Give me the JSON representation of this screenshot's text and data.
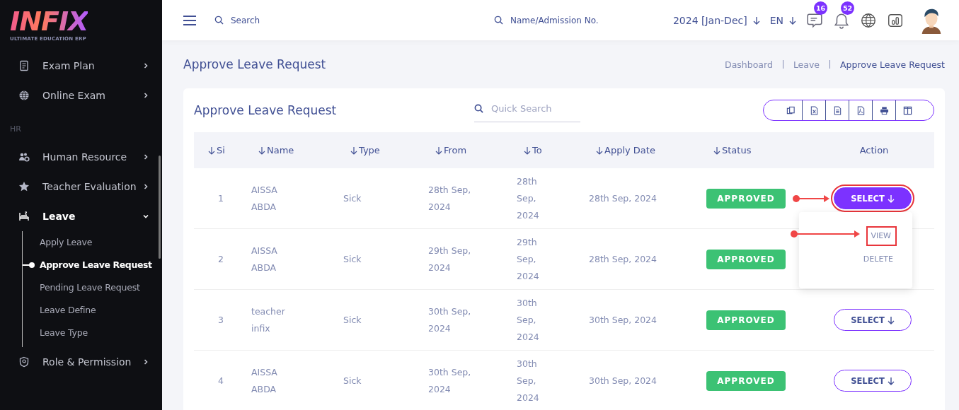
{
  "brand": {
    "name": "INFIX",
    "tagline": "ULTIMATE EDUCATION ERP"
  },
  "sidebar": {
    "items": [
      {
        "label": "Exam Plan",
        "expanded": false
      },
      {
        "label": "Online Exam",
        "expanded": false
      }
    ],
    "section": "HR",
    "section_items": [
      {
        "label": "Human Resource",
        "expanded": false
      },
      {
        "label": "Teacher Evaluation",
        "expanded": false
      },
      {
        "label": "Leave",
        "expanded": true,
        "children": [
          {
            "label": "Apply Leave",
            "selected": false
          },
          {
            "label": "Approve Leave Request",
            "selected": true
          },
          {
            "label": "Pending Leave Request",
            "selected": false
          },
          {
            "label": "Leave Define",
            "selected": false
          },
          {
            "label": "Leave Type",
            "selected": false
          }
        ]
      },
      {
        "label": "Role & Permission",
        "expanded": false
      }
    ]
  },
  "topbar": {
    "search": {
      "placeholder": "Search"
    },
    "student_search": {
      "placeholder": "Name/Admission No."
    },
    "session": "2024 [Jan-Dec]",
    "language": "EN",
    "messages_badge": "16",
    "notifications_badge": "52"
  },
  "page": {
    "title": "Approve Leave Request",
    "breadcrumb": [
      {
        "label": "Dashboard",
        "selected": false
      },
      {
        "label": "Leave",
        "selected": false
      },
      {
        "label": "Approve Leave Request",
        "selected": true
      }
    ]
  },
  "card": {
    "title": "Approve Leave Request",
    "quick_search": {
      "placeholder": "Quick Search"
    }
  },
  "table": {
    "columns": [
      "Si",
      "Name",
      "Type",
      "From",
      "To",
      "Apply Date",
      "Status",
      "Action"
    ],
    "rows": [
      {
        "si": "1",
        "name": "AISSA ABDA",
        "type": "Sick",
        "from": "28th Sep, 2024",
        "to": "28th Sep, 2024",
        "apply_date": "28th Sep, 2024",
        "status": "APPROVED",
        "action": {
          "label": "SELECT",
          "expanded": true,
          "highlighted": true,
          "menu": [
            {
              "label": "VIEW",
              "highlighted": true
            },
            {
              "label": "DELETE",
              "highlighted": false
            }
          ]
        }
      },
      {
        "si": "2",
        "name": "AISSA ABDA",
        "type": "Sick",
        "from": "29th Sep, 2024",
        "to": "29th Sep, 2024",
        "apply_date": "28th Sep, 2024",
        "status": "APPROVED"
      },
      {
        "si": "3",
        "name": "teacher infix",
        "type": "Sick",
        "from": "30th Sep, 2024",
        "to": "30th Sep, 2024",
        "apply_date": "30th Sep, 2024",
        "status": "APPROVED",
        "action": {
          "label": "SELECT",
          "expanded": false,
          "highlighted": false
        }
      },
      {
        "si": "4",
        "name": "AISSA ABDA",
        "type": "Sick",
        "from": "30th Sep, 2024",
        "to": "30th Sep, 2024",
        "apply_date": "30th Sep, 2024",
        "status": "APPROVED",
        "action": {
          "label": "SELECT",
          "expanded": false,
          "highlighted": false
        }
      }
    ]
  }
}
